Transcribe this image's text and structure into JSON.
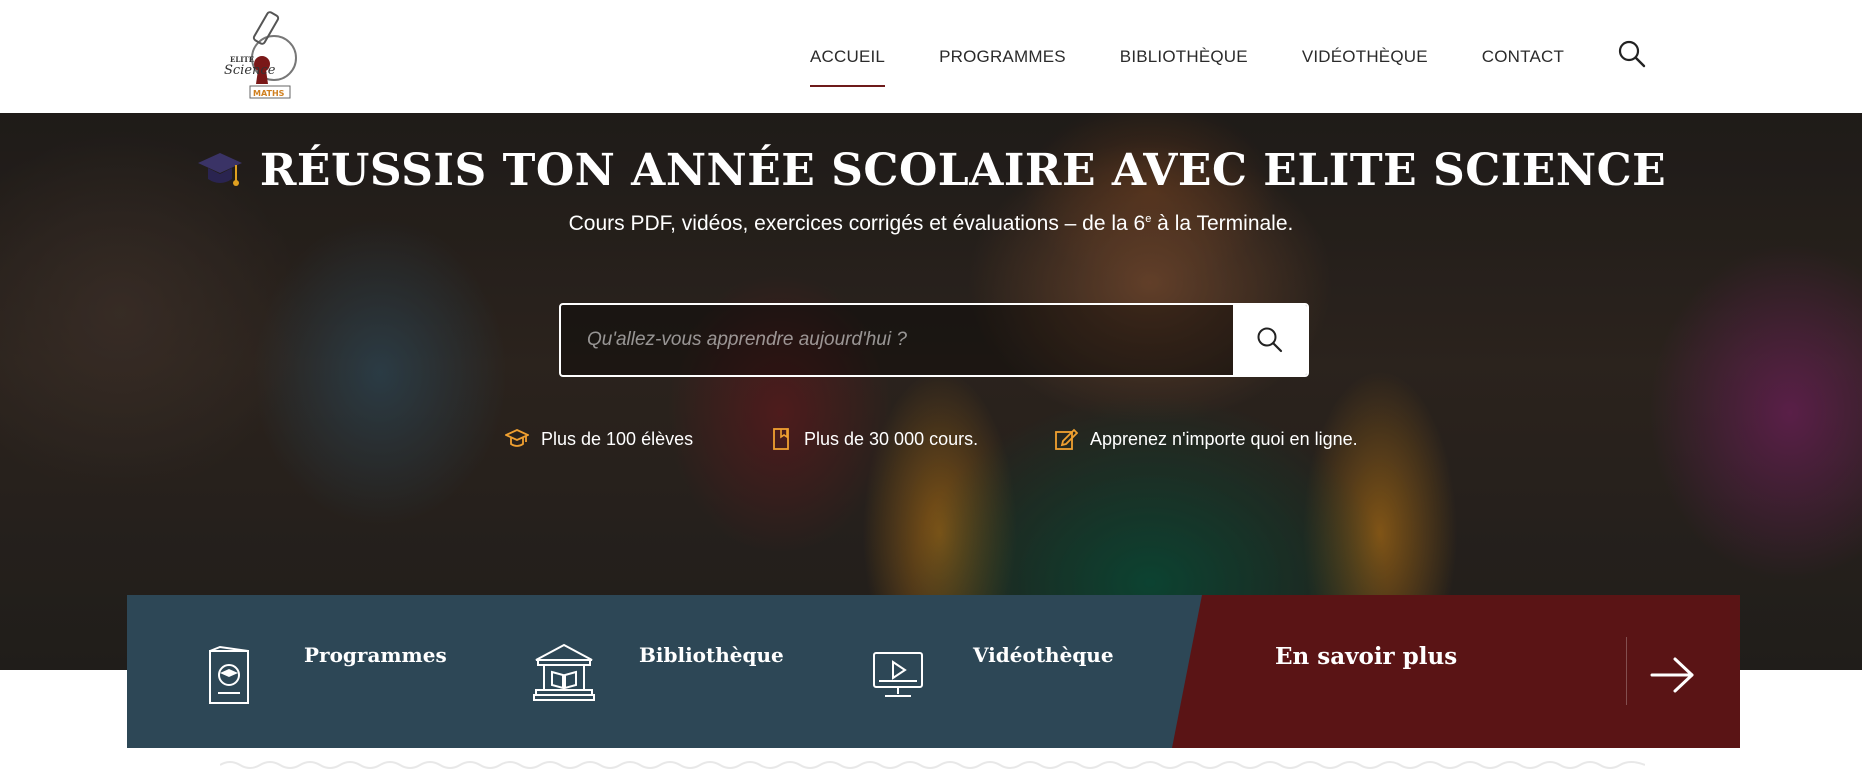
{
  "header": {
    "logo_text": "ELITE Science MATHS",
    "nav": [
      {
        "label": "ACCUEIL",
        "active": true
      },
      {
        "label": "PROGRAMMES"
      },
      {
        "label": "BIBLIOTHÈQUE"
      },
      {
        "label": "VIDÉOTHÈQUE"
      },
      {
        "label": "CONTACT"
      }
    ],
    "search_icon": "search-icon"
  },
  "hero": {
    "title": "RÉUSSIS TON ANNÉE SCOLAIRE AVEC ELITE SCIENCE",
    "title_icon": "graduation-cap-icon",
    "subtitle_before": "Cours PDF, vidéos, exercices corrigés et évaluations – de la 6",
    "subtitle_sup": "e",
    "subtitle_after": " à la Terminale.",
    "search": {
      "placeholder": "Qu'allez-vous apprendre aujourd'hui ?",
      "value": ""
    },
    "features": [
      {
        "icon": "teacher-icon",
        "text": "Plus de 100 élèves"
      },
      {
        "icon": "book-icon",
        "text": "Plus de 30 000 cours."
      },
      {
        "icon": "edit-icon",
        "text": "Apprenez n'importe quoi en ligne."
      }
    ]
  },
  "strip": {
    "cards": [
      {
        "icon": "certificate-icon",
        "label": "Programmes"
      },
      {
        "icon": "library-icon",
        "label": "Bibliothèque"
      },
      {
        "icon": "video-icon",
        "label": "Vidéothèque"
      }
    ],
    "more_label": "En savoir plus",
    "more_icon": "arrow-right-icon"
  },
  "colors": {
    "accent": "#6e1a1a",
    "strip_blue": "#2d4756",
    "strip_red": "#5a1415",
    "feature_icon": "#f0a030"
  }
}
